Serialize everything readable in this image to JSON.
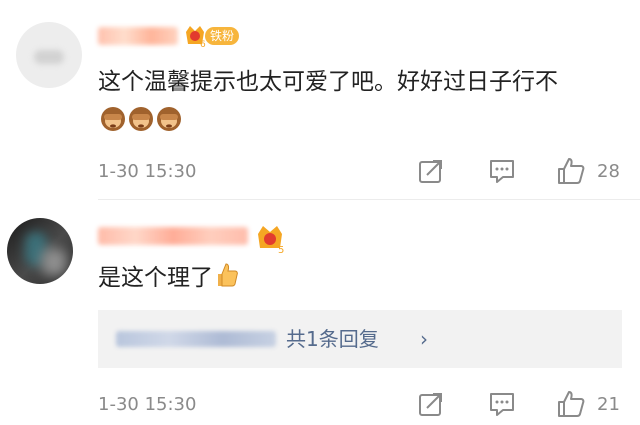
{
  "comments": [
    {
      "username": "",
      "fan_badge": "铁粉",
      "crown_level": "6",
      "text": "这个温馨提示也太可爱了吧。好好过日子行不",
      "emoji": "see-no-evil-monkey",
      "emoji_count": 3,
      "time": "1-30 15:30",
      "likes": "28",
      "icons": {
        "share": "share-icon",
        "comment": "comment-icon",
        "like": "thumbs-up-icon"
      }
    },
    {
      "username": "",
      "crown_level": "5",
      "text": "是这个理了",
      "emoji": "thumbs-up",
      "reply_summary": "共1条回复",
      "reply_chevron": "›",
      "time": "1-30 15:30",
      "likes": "21",
      "icons": {
        "share": "share-icon",
        "comment": "comment-icon",
        "like": "thumbs-up-icon"
      }
    }
  ],
  "colors": {
    "badge": "#f7b53c",
    "link": "#556b8d",
    "meta": "#8a8a8a",
    "reply_bg": "#f2f2f2"
  }
}
